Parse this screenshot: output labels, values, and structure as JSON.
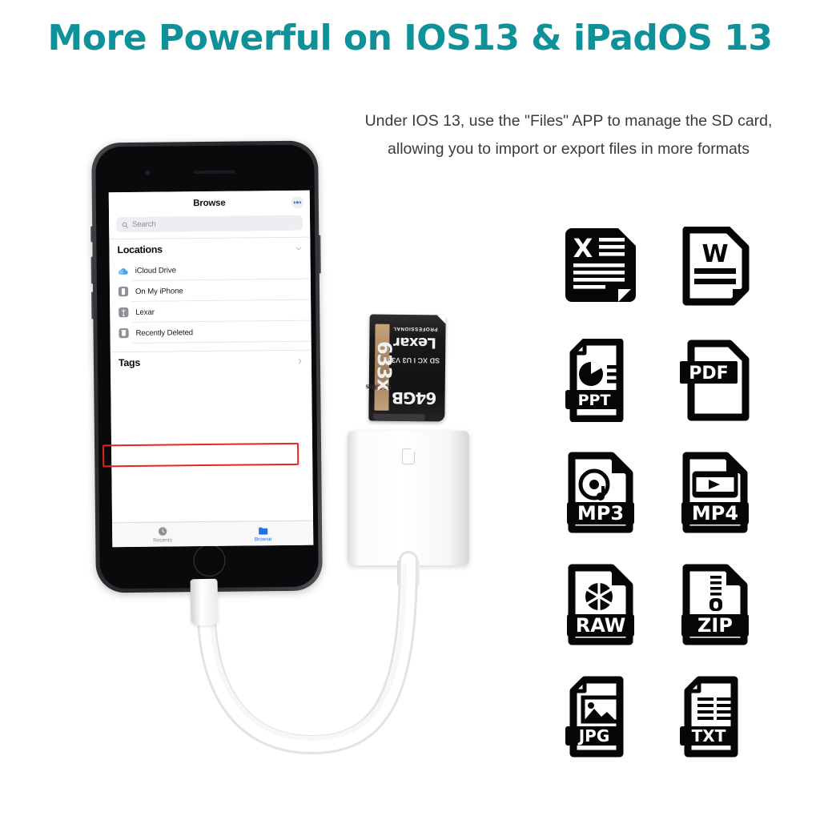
{
  "page": {
    "background_color": "#ffffff",
    "headline": "More Powerful on IOS13 & iPadOS 13",
    "headline_color": "#0f9199",
    "subtitle_line1": "Under IOS 13, use the \"Files\" APP to manage the SD card,",
    "subtitle_line2": "allowing you to import or export files in more formats"
  },
  "phone": {
    "device": "iPhone",
    "body_color": "#2f3034",
    "files_app": {
      "nav": {
        "title": "Browse",
        "more_button": "more-options"
      },
      "search": {
        "placeholder": "Search",
        "icon": "search-icon"
      },
      "locations_section": {
        "title": "Locations",
        "chevron": "chevron-down-icon",
        "items": [
          {
            "label": "iCloud Drive",
            "icon": "icloud-icon",
            "highlighted": false
          },
          {
            "label": "On My iPhone",
            "icon": "iphone-icon",
            "highlighted": false
          },
          {
            "label": "Lexar",
            "icon": "usb-drive-icon",
            "highlighted": true
          },
          {
            "label": "Recently Deleted",
            "icon": "trash-icon",
            "highlighted": false
          }
        ]
      },
      "tags_section": {
        "title": "Tags",
        "chevron": "chevron-right-icon"
      },
      "highlight_color": "#e7241e",
      "tabbar": [
        {
          "label": "Recents",
          "icon": "clock-icon",
          "active": false
        },
        {
          "label": "Browse",
          "icon": "folder-icon",
          "active": true
        }
      ],
      "accent_color": "#1d72e8"
    }
  },
  "sd_card": {
    "brand": "Lexar",
    "line_professional": "PROFESSIONAL",
    "speed_rating": "633x",
    "specs": "SD XC I U3 V30",
    "capacity": "64GB",
    "transfer_speed": "95 MB/s"
  },
  "adapter": {
    "name": "sd-card-reader-adapter",
    "color": "#ffffff",
    "slot_symbol": "sd-card-slot-icon",
    "cable": "lightning-cable",
    "connector": "lightning-connector"
  },
  "file_formats": [
    {
      "label": "XLS",
      "icon": "excel-file-icon",
      "style": "solid",
      "glyph": "X"
    },
    {
      "label": "DOC",
      "icon": "word-file-icon",
      "style": "outline",
      "glyph": "W"
    },
    {
      "label": "PPT",
      "icon": "powerpoint-file-icon",
      "style": "outline",
      "glyph": "PPT"
    },
    {
      "label": "PDF",
      "icon": "pdf-file-icon",
      "style": "outline",
      "glyph": "PDF"
    },
    {
      "label": "MP3",
      "icon": "mp3-file-icon",
      "style": "outline",
      "glyph": "MP3"
    },
    {
      "label": "MP4",
      "icon": "mp4-file-icon",
      "style": "outline",
      "glyph": "MP4"
    },
    {
      "label": "RAW",
      "icon": "raw-file-icon",
      "style": "outline",
      "glyph": "RAW"
    },
    {
      "label": "ZIP",
      "icon": "zip-file-icon",
      "style": "outline",
      "glyph": "ZIP"
    },
    {
      "label": "JPG",
      "icon": "jpg-file-icon",
      "style": "outline",
      "glyph": "JPG"
    },
    {
      "label": "TXT",
      "icon": "txt-file-icon",
      "style": "outline",
      "glyph": "TXT"
    }
  ]
}
